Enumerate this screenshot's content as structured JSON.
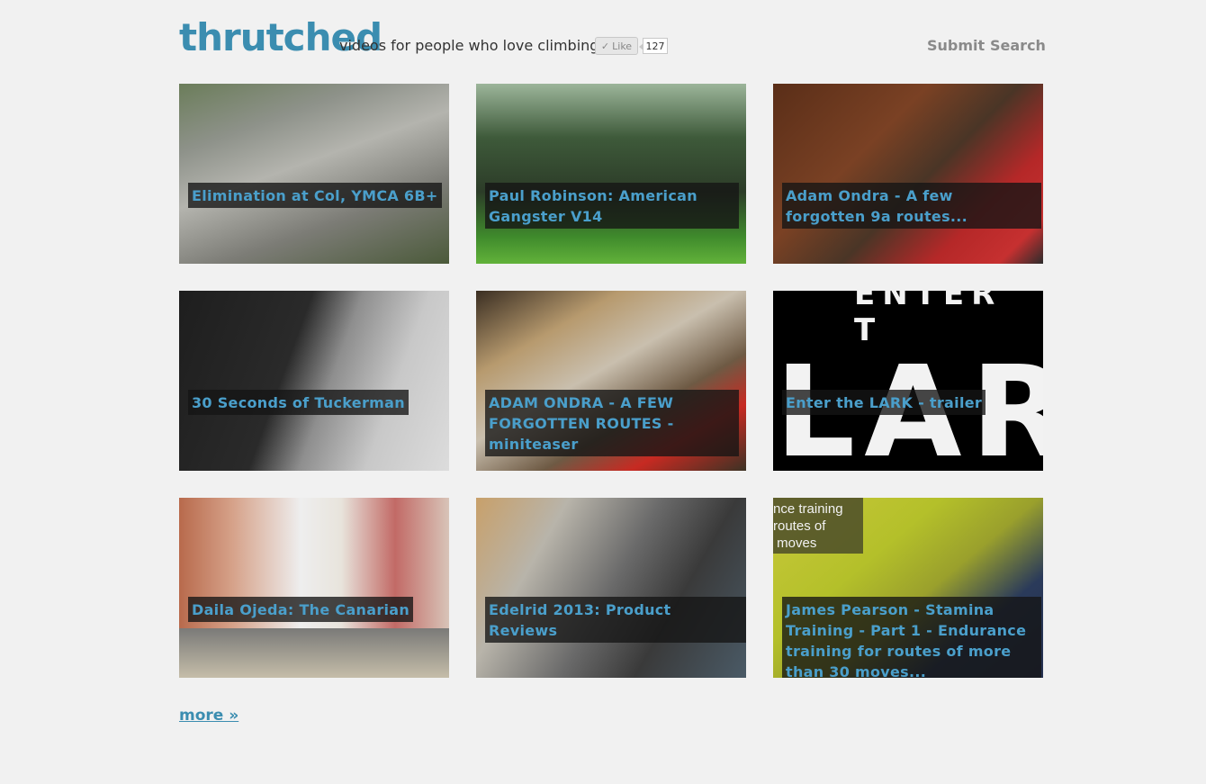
{
  "header": {
    "logo": "thrutched",
    "tagline": "videos for people who love climbing",
    "like_label": "Like",
    "like_count": "127",
    "nav": {
      "submit": "Submit",
      "search": "Search"
    }
  },
  "videos": [
    {
      "title": "Elimination at Col, YMCA 6B+"
    },
    {
      "title": "Paul Robinson: American Gangster V14"
    },
    {
      "title": "Adam Ondra - A few forgotten 9a routes..."
    },
    {
      "title": "30 Seconds of Tuckerman"
    },
    {
      "title": "ADAM ONDRA - A FEW FORGOTTEN ROUTES - miniteaser"
    },
    {
      "title": "Enter the LARK - trailer"
    },
    {
      "title": "Daila Ojeda: The Canarian"
    },
    {
      "title": "Edelrid 2013: Product Reviews"
    },
    {
      "title": "James Pearson - Stamina Training - Part 1 - Endurance training for routes of more than 30 moves..."
    }
  ],
  "thumb_text": {
    "lark_top": "ENTER T",
    "lark_big": "LARK",
    "james_overlay": "nce training\nroutes of\n moves"
  },
  "more_link": "more »",
  "colors": {
    "accent": "#3b8db0",
    "caption_text": "#4a9fcb",
    "background": "#f1f1f1"
  }
}
